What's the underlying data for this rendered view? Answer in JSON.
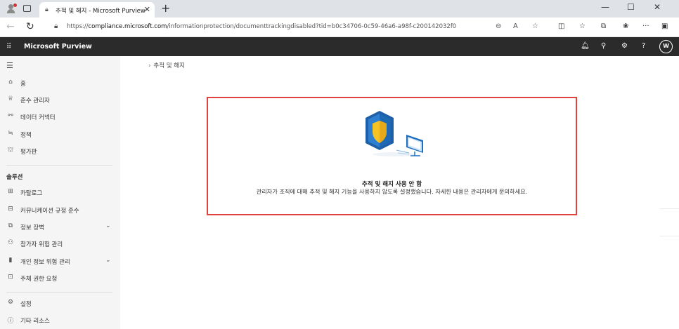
{
  "browser": {
    "tab_title": "추적 및 해지 - Microsoft Purview",
    "url_prefix": "https://",
    "url_host": "compliance.microsoft.com",
    "url_path": "/informationprotection/documenttrackingdisabled?tid=b0c34706-0c59-46a6-a98f-c200142032f0"
  },
  "app": {
    "brand": "Microsoft Purview",
    "avatar_initial": "W"
  },
  "nav": {
    "items": [
      {
        "label": "홈",
        "icon": "home-icon"
      },
      {
        "label": "준수 관리자",
        "icon": "trophy-icon"
      },
      {
        "label": "데이터 커넥터",
        "icon": "connector-icon"
      },
      {
        "label": "정책",
        "icon": "policy-icon"
      },
      {
        "label": "평가판",
        "icon": "trial-icon"
      }
    ],
    "solutions_header": "솔루션",
    "solutions": [
      {
        "label": "카탈로그",
        "icon": "catalog-icon",
        "expandable": false
      },
      {
        "label": "커뮤니케이션 규정 준수",
        "icon": "chat-icon",
        "expandable": false
      },
      {
        "label": "정보 장벽",
        "icon": "barrier-icon",
        "expandable": true
      },
      {
        "label": "참가자 위험 관리",
        "icon": "people-icon",
        "expandable": false
      },
      {
        "label": "개인 정보 위험 관리",
        "icon": "privacy-icon",
        "expandable": true
      },
      {
        "label": "주체 권한 요청",
        "icon": "request-icon",
        "expandable": false
      }
    ],
    "footer": [
      {
        "label": "설정",
        "icon": "settings-icon"
      },
      {
        "label": "기타 리소스",
        "icon": "info-icon"
      }
    ]
  },
  "main": {
    "breadcrumb": "추적 및 해지",
    "message_title": "추적 및 해지 사용 안 함",
    "message_body": "관리자가 조직에 대해 추적 및 해지 기능을 사용하지 않도록 설정했습니다. 자세한 내용은 관리자에게 문의하세요."
  },
  "colors": {
    "header_bg": "#2b2b2b",
    "nav_bg": "#f5f5f5",
    "highlight_border": "#e0433e",
    "shield_blue": "#1e6fb8",
    "shield_yellow": "#f6c324"
  }
}
